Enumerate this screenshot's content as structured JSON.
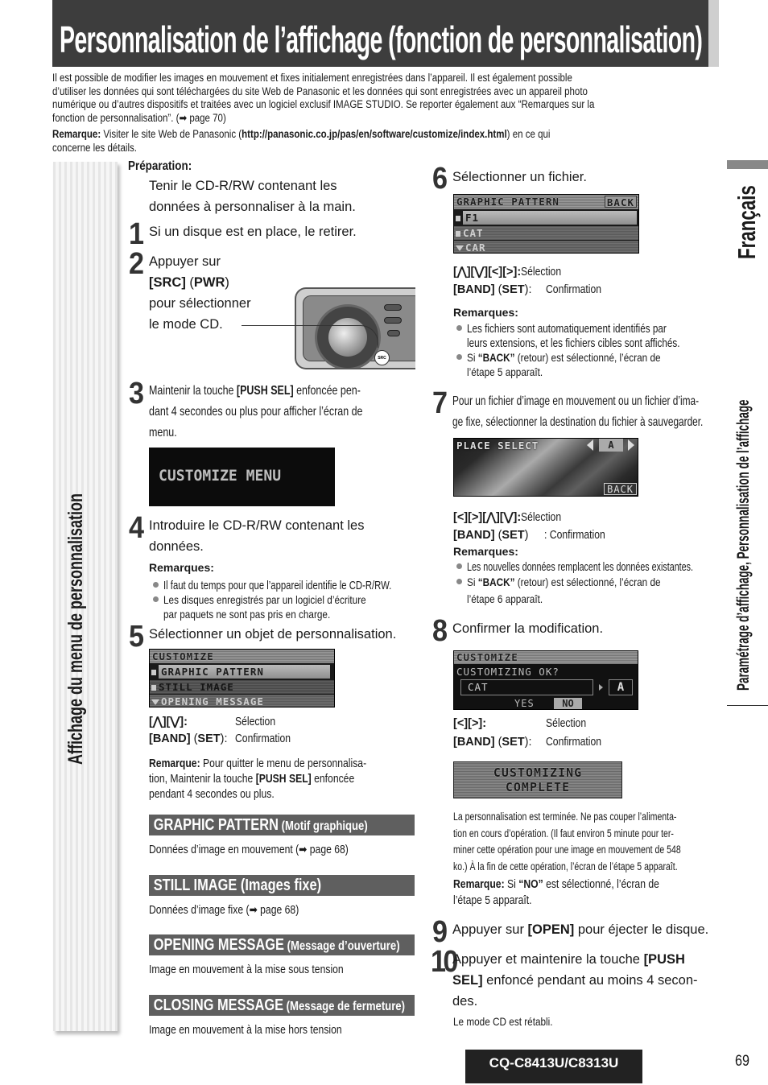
{
  "header": {
    "title": "Personnalisation de l’affichage (fonction de personnalisation)"
  },
  "intro": {
    "lines": [
      "Il est possible de modifier les images en mouvement et fixes initialement enregistrées dans l’appareil. Il est également possible",
      "d’utiliser les données qui sont téléchargées du site Web de Panasonic et les données qui sont enregistrées avec un appareil photo",
      "numérique ou d’autres dispositifs et traitées avec un logiciel exclusif IMAGE STUDIO. Se reporter également aux “Remarques sur la",
      "fonction de personnalisation”. (➡ page 70)"
    ],
    "remark_label": "Remarque:",
    "remark_text_before": " Visiter le site Web de Panasonic (",
    "remark_url": "http://panasonic.co.jp/pas/en/software/customize/index.html",
    "remark_text_after": ") en ce qui",
    "remark_line2": "concerne les détails."
  },
  "left_tab": {
    "label": "Affichage du menu de personnalisation"
  },
  "sidebar": {
    "language": "Français",
    "section": "Paramétrage d’affichage, Personnalisation de l’affichage"
  },
  "preparation": {
    "label": "Préparation:",
    "line1": "Tenir le CD-R/RW contenant les",
    "line2": "données à personnaliser à la main."
  },
  "steps": {
    "s1": {
      "num": "1",
      "text": "Si un disque est en place, le retirer."
    },
    "s2": {
      "num": "2",
      "l1": "Appuyer sur",
      "l2a": "[SRC]",
      "l2b": " (",
      "l2c": "PWR",
      "l2d": ")",
      "l3": "pour sélectionner",
      "l4": "le mode CD.",
      "device": {
        "src": "SRC"
      }
    },
    "s3": {
      "num": "3",
      "l1a": "Maintenir la touche ",
      "l1b": "[PUSH SEL]",
      "l1c": " enfoncée pen-",
      "l2": "dant 4 secondes ou plus pour afficher l’écran de",
      "l3": "menu.",
      "screen": "CUSTOMIZE MENU"
    },
    "s4": {
      "num": "4",
      "l1": "Introduire le CD-R/RW contenant les",
      "l2": "données.",
      "remarks_label": "Remarques:",
      "bullets": [
        "Il faut du temps pour que l’appareil identifie le CD-R/RW.",
        "Les disques enregistrés par un logiciel d’écriture",
        "par paquets ne sont pas pris en charge."
      ]
    },
    "s5": {
      "num": "5",
      "text": "Sélectionner un objet de personnalisation.",
      "screen": {
        "header": "CUSTOMIZE",
        "rows": [
          "GRAPHIC PATTERN",
          "STILL IMAGE",
          "OPENING MESSAGE"
        ]
      },
      "keys_a": "[⋀][⋁]:",
      "keys_a_action": "Sélection",
      "keys_b1": "[BAND]",
      "keys_b2": " (",
      "keys_b3": "SET",
      "keys_b4": "):",
      "keys_b_action": "Confirmation",
      "remark_label": "Remarque:",
      "remark_l1": " Pour quitter le menu de personnalisa-",
      "remark_l2a": "tion, Maintenir la touche ",
      "remark_l2b": "[PUSH SEL]",
      "remark_l2c": " enfoncée",
      "remark_l3": "pendant 4 secondes ou plus."
    },
    "s6": {
      "num": "6",
      "text": "Sélectionner un fichier.",
      "screen": {
        "header": "GRAPHIC PATTERN",
        "back": "BACK",
        "rows": [
          "F1",
          "CAT",
          "CAR"
        ]
      },
      "keys_a": "[⋀][⋁][<][>]:",
      "keys_a_action": "Sélection",
      "keys_b1": "[BAND]",
      "keys_b2": " (",
      "keys_b3": "SET",
      "keys_b4": "):",
      "keys_b_action": "Confirmation",
      "remarks_label": "Remarques:",
      "bullets": [
        "Les fichiers sont automatiquement identifiés par",
        "leurs extensions, et les fichiers cibles sont affichés."
      ],
      "bullet2_a": "Si ",
      "bullet2_b": "“BACK”",
      "bullet2_c": " (retour) est sélectionné, l’écran de",
      "bullet2_l2": "l’étape 5 apparaît."
    },
    "s7": {
      "num": "7",
      "l1": "Pour un fichier d’image en mouvement ou un fichier d’ima-",
      "l2": "ge fixe, sélectionner la destination du fichier à sauvegarder.",
      "screen": {
        "header": "PLACE SELECT",
        "value": "A",
        "back": "BACK"
      },
      "keys_a": "[<][>][⋀][⋁]:",
      "keys_a_action": " Sélection",
      "keys_b1": "[BAND]",
      "keys_b2": " (",
      "keys_b3": "SET",
      "keys_b4": ")",
      "keys_b_action": ": Confirmation",
      "remarks_label": "Remarques:",
      "bullet1": "Les nouvelles données remplacent les données existantes.",
      "bullet2_a": "Si ",
      "bullet2_b": "“BACK”",
      "bullet2_c": " (retour) est sélectionné, l’écran de",
      "bullet2_l2": "l’étape 6 apparaît."
    },
    "s8": {
      "num": "8",
      "text": "Confirmer la modification.",
      "screen": {
        "header": "CUSTOMIZE",
        "question": "CUSTOMIZING OK?",
        "file": "CAT",
        "dest": "A",
        "yes": "YES",
        "no": "NO"
      },
      "keys_a": "[<][>]:",
      "keys_a_action": "Sélection",
      "keys_b1": "[BAND]",
      "keys_b2": " (",
      "keys_b3": "SET",
      "keys_b4": "):",
      "keys_b_action": "Confirmation",
      "complete_l1": "CUSTOMIZING",
      "complete_l2": "COMPLETE",
      "info": [
        "La personnalisation est terminée. Ne pas couper l’alimenta-",
        "tion en cours d’opération. (Il faut environ 5 minute pour ter-",
        "miner cette opération pour une image en mouvement de 548",
        "ko.) À la fin de cette opération, l’écran de l’étape 5 apparaît."
      ],
      "remark_label": "Remarque:",
      "remark_a": " Si ",
      "remark_b": "“NO”",
      "remark_c": " est sélectionné, l’écran de",
      "remark_l2": "l’étape 5 apparaît."
    },
    "s9": {
      "num": "9",
      "a": "Appuyer sur ",
      "b": "[OPEN]",
      "c": " pour éjecter le disque."
    },
    "s10": {
      "num": "10",
      "l1a": "Appuyer et maintenire la touche ",
      "l1b": "[PUSH",
      "l2a": "SEL]",
      "l2b": " enfoncé pendant au moins 4 secon-",
      "l3": "des.",
      "note": "Le mode CD est rétabli."
    }
  },
  "sections": [
    {
      "title": "GRAPHIC PATTERN",
      "subtitle": " (Motif graphique)",
      "desc": "Données d’image en mouvement (➡ page 68)"
    },
    {
      "title": "STILL IMAGE",
      "subtitle": " (Images fixe)",
      "desc": "Données d’image fixe (➡ page 68)"
    },
    {
      "title": "OPENING MESSAGE",
      "subtitle": " (Message d’ouverture)",
      "desc": "Image en mouvement à la mise sous tension"
    },
    {
      "title": "CLOSING MESSAGE",
      "subtitle": " (Message de fermeture)",
      "desc": "Image en mouvement à la mise hors tension"
    }
  ],
  "footer": {
    "model": "CQ-C8413U/C8313U",
    "page": "69"
  }
}
